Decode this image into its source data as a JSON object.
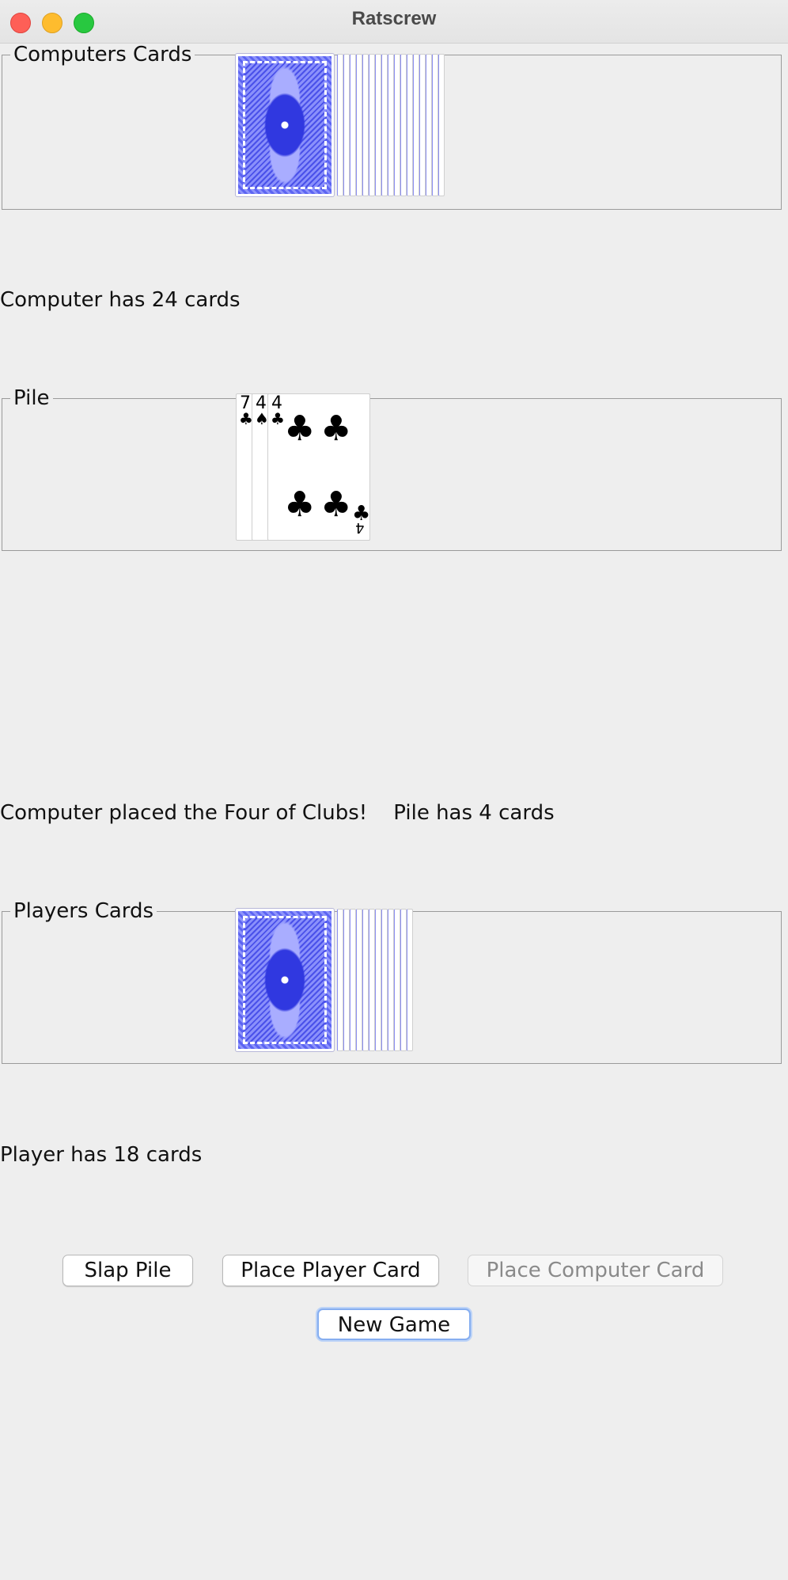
{
  "window": {
    "title": "Ratscrew"
  },
  "computer_panel": {
    "legend": "Computers Cards"
  },
  "computer_status": "Computer has 24 cards",
  "pile_panel": {
    "legend": "Pile",
    "cards": [
      {
        "rank": "7",
        "suit": "♣"
      },
      {
        "rank": "4",
        "suit": "♠"
      },
      {
        "rank": "4",
        "suit": "♣"
      }
    ]
  },
  "message": {
    "text": "Computer placed the Four of Clubs!",
    "pile_count": "Pile has 4 cards"
  },
  "player_panel": {
    "legend": "Players Cards"
  },
  "player_status": "Player has 18 cards",
  "buttons": {
    "slap": "Slap Pile",
    "place_player": "Place Player Card",
    "place_computer": "Place Computer Card",
    "new_game": "New Game"
  },
  "colors": {
    "card_back": "#5c64f2",
    "close": "#fe5f57",
    "minimize": "#febc2e",
    "maximize": "#28c840"
  }
}
